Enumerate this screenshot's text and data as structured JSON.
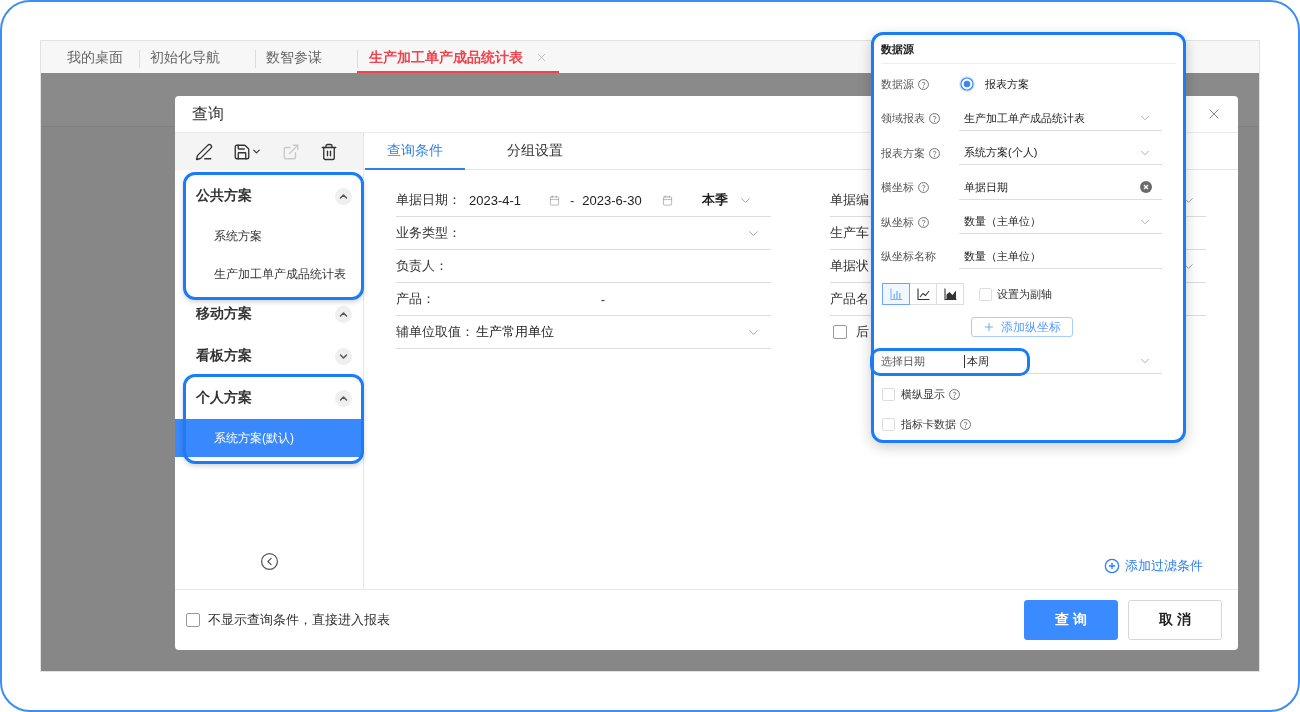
{
  "app_tabs": [
    {
      "label": "我的桌面",
      "selected": false,
      "closable": false
    },
    {
      "label": "初始化导航",
      "selected": false,
      "closable": false
    },
    {
      "label": "数智参谋",
      "selected": false,
      "closable": false
    },
    {
      "label": "生产加工单产成品统计表",
      "selected": true,
      "closable": true
    }
  ],
  "dialog": {
    "title": "查询",
    "toolbar": [
      {
        "kind": "edit",
        "disabled": false
      },
      {
        "kind": "save",
        "disabled": false
      },
      {
        "kind": "share",
        "disabled": true
      },
      {
        "kind": "delete",
        "disabled": false
      }
    ],
    "schemes": [
      {
        "label": "公共方案",
        "expanded": true,
        "highlighted": true,
        "children": [
          {
            "label": "系统方案",
            "selected": false
          },
          {
            "label": "生产加工单产成品统计表",
            "selected": false
          }
        ]
      },
      {
        "label": "移动方案",
        "expanded": true,
        "highlighted": false
      },
      {
        "label": "看板方案",
        "expanded": false,
        "highlighted": false
      },
      {
        "label": "个人方案",
        "expanded": true,
        "highlighted": true,
        "children": [
          {
            "label": "系统方案(默认)",
            "selected": true
          }
        ]
      }
    ],
    "tabs": [
      {
        "label": "查询条件",
        "selected": true
      },
      {
        "label": "分组设置",
        "selected": false
      }
    ],
    "filters_left": [
      {
        "kind": "daterange",
        "label": "单据日期：",
        "from": "2023-4-1",
        "separator": "-",
        "to": "2023-6-30",
        "preset": "本季"
      },
      {
        "kind": "select",
        "label": "业务类型："
      },
      {
        "kind": "text",
        "label": "负责人："
      },
      {
        "kind": "range",
        "label": "产品：",
        "separator": "-"
      },
      {
        "kind": "select",
        "label": "辅单位取值：",
        "value": "生产常用单位"
      }
    ],
    "filters_right": [
      {
        "kind": "select",
        "label": "单据编"
      },
      {
        "kind": "text",
        "label": "生产车"
      },
      {
        "kind": "select",
        "label": "单据状"
      },
      {
        "kind": "text",
        "label": "产品名"
      },
      {
        "kind": "checkbox",
        "label": "后",
        "checked": false
      }
    ],
    "add_filter": {
      "label": "添加过滤条件"
    },
    "skip_conditions": {
      "label": "不显示查询条件，直接进入报表",
      "checked": false
    },
    "buttons": [
      {
        "kind": "primary",
        "label": "查 询"
      },
      {
        "kind": "default",
        "label": "取 消"
      }
    ]
  },
  "datasource_panel": {
    "title": "数据源",
    "highlighted": true,
    "rows": [
      {
        "kind": "radio",
        "label": "数据源",
        "help": true,
        "value": "报表方案",
        "checked": true
      },
      {
        "kind": "select",
        "label": "领域报表",
        "help": true,
        "value": "生产加工单产成品统计表"
      },
      {
        "kind": "select",
        "label": "报表方案",
        "help": true,
        "value": "系统方案(个人)"
      },
      {
        "kind": "clearable",
        "label": "横坐标",
        "help": true,
        "value": "单据日期"
      },
      {
        "kind": "select",
        "label": "纵坐标",
        "help": true,
        "value": "数量（主单位）"
      },
      {
        "kind": "input",
        "label": "纵坐标名称",
        "help": false,
        "value": "数量（主单位）"
      }
    ],
    "chart_types": [
      {
        "kind": "bar",
        "selected": true
      },
      {
        "kind": "line",
        "selected": false
      },
      {
        "kind": "area",
        "selected": false
      }
    ],
    "secondary_axis": {
      "label": "设置为副轴",
      "checked": false
    },
    "add_axis": {
      "label": "添加纵坐标"
    },
    "date_select": {
      "label": "选择日期",
      "value": "本周",
      "focused": true,
      "highlighted": true
    },
    "options": [
      {
        "label": "横纵显示",
        "help": true,
        "checked": false
      },
      {
        "label": "指标卡数据",
        "help": true,
        "checked": false
      }
    ]
  }
}
